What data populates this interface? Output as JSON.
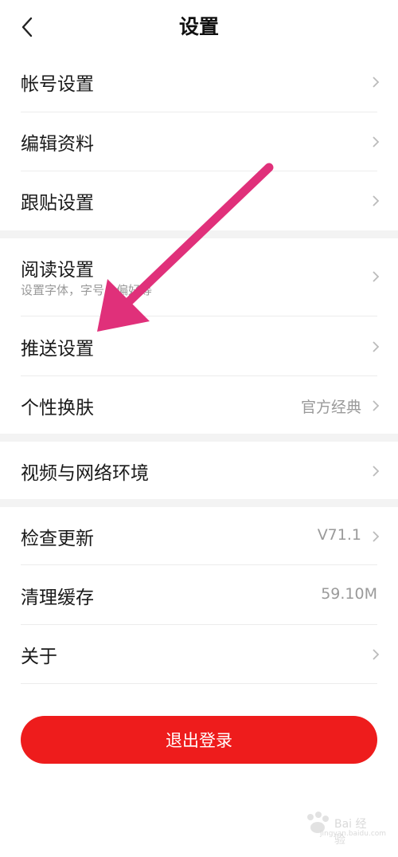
{
  "header": {
    "title": "设置",
    "back_icon": "chevron-left-icon"
  },
  "items": {
    "account": {
      "label": "帐号设置"
    },
    "profile": {
      "label": "编辑资料"
    },
    "comment": {
      "label": "跟贴设置"
    },
    "reading": {
      "label": "阅读设置",
      "sublabel": "设置字体，字号，偏好等"
    },
    "push": {
      "label": "推送设置"
    },
    "skin": {
      "label": "个性换肤",
      "value": "官方经典"
    },
    "network": {
      "label": "视频与网络环境"
    },
    "update": {
      "label": "检查更新",
      "value": "V71.1"
    },
    "cache": {
      "label": "清理缓存",
      "value": "59.10M"
    },
    "about": {
      "label": "关于"
    }
  },
  "logout": {
    "label": "退出登录"
  },
  "watermark": {
    "text": "Bai 经验",
    "sub": "jingyan.baidu.com"
  },
  "colors": {
    "accent": "#ee1c1c",
    "annotation_arrow": "#e0307a",
    "gap": "#f3f3f3"
  }
}
